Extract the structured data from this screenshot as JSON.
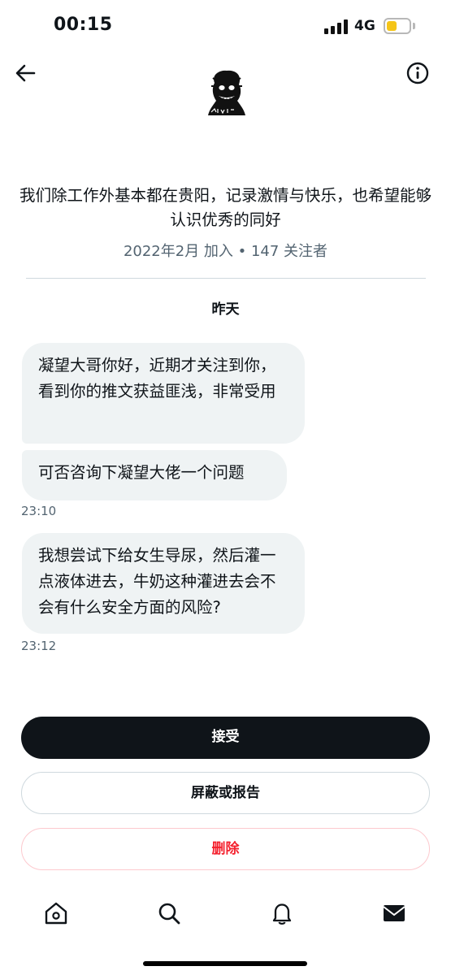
{
  "status_bar": {
    "time": "00:15",
    "network": "4G",
    "battery_level": 0.45,
    "battery_color": "#f5c518"
  },
  "header": {
    "back_icon": "arrow-left-icon",
    "info_icon": "info-circle-icon"
  },
  "profile": {
    "bio": "我们除工作外基本都在贵阳，记录激情与快乐，也希望能够认识优秀的同好",
    "meta": "2022年2月 加入 • 147 关注者"
  },
  "conversation": {
    "date_label": "昨天",
    "messages": [
      {
        "text": "凝望大哥你好，近期才关注到你，看到你的推文获益匪浅，非常受用"
      },
      {
        "text": "可否咨询下凝望大佬一个问题",
        "time": "23:10"
      },
      {
        "text": "我想尝试下给女生导尿，然后灌一点液体进去，牛奶这种灌进去会不会有什么安全方面的风险?",
        "time": "23:12"
      }
    ]
  },
  "actions": {
    "accept": "接受",
    "block_report": "屏蔽或报告",
    "delete": "删除"
  },
  "tabbar": {
    "items": [
      "home-icon",
      "search-icon",
      "bell-icon",
      "mail-icon"
    ]
  },
  "colors": {
    "accent_dark": "#0f1419",
    "danger": "#f4212e",
    "muted": "#536471",
    "bubble": "#eff3f4"
  }
}
